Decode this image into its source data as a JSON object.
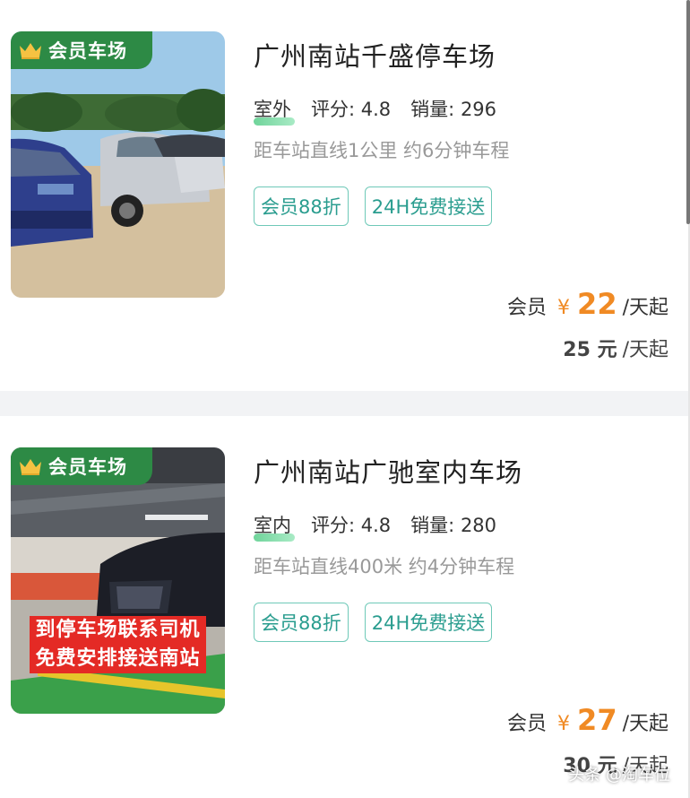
{
  "listings": [
    {
      "badge": "会员车场",
      "title": "广州南站千盛停车场",
      "type": "室外",
      "rating_label": "评分:",
      "rating": "4.8",
      "sales_label": "销量:",
      "sales": "296",
      "distance": "距车站直线1公里 约6分钟车程",
      "tags": [
        "会员88折",
        "24H免费接送"
      ],
      "member_label": "会员",
      "currency": "¥",
      "member_price": "22",
      "unit": "/天起",
      "original_price": "25 元",
      "original_unit": "/天起",
      "promo": []
    },
    {
      "badge": "会员车场",
      "title": "广州南站广驰室内车场",
      "type": "室内",
      "rating_label": "评分:",
      "rating": "4.8",
      "sales_label": "销量:",
      "sales": "280",
      "distance": "距车站直线400米 约4分钟车程",
      "tags": [
        "会员88折",
        "24H免费接送"
      ],
      "member_label": "会员",
      "currency": "¥",
      "member_price": "27",
      "unit": "/天起",
      "original_price": "30 元",
      "original_unit": "/天起",
      "promo": [
        "到停车场联系司机",
        "免费安排接送南站"
      ]
    }
  ],
  "watermark": "头条 @淘车位",
  "colors": {
    "badge_green": "#2d8a45",
    "tag_border": "#6fc9b8",
    "tag_text": "#2a9d8f",
    "price_orange": "#f08a24",
    "promo_red": "#e42a25"
  },
  "icons": {
    "badge": "crown-icon"
  }
}
